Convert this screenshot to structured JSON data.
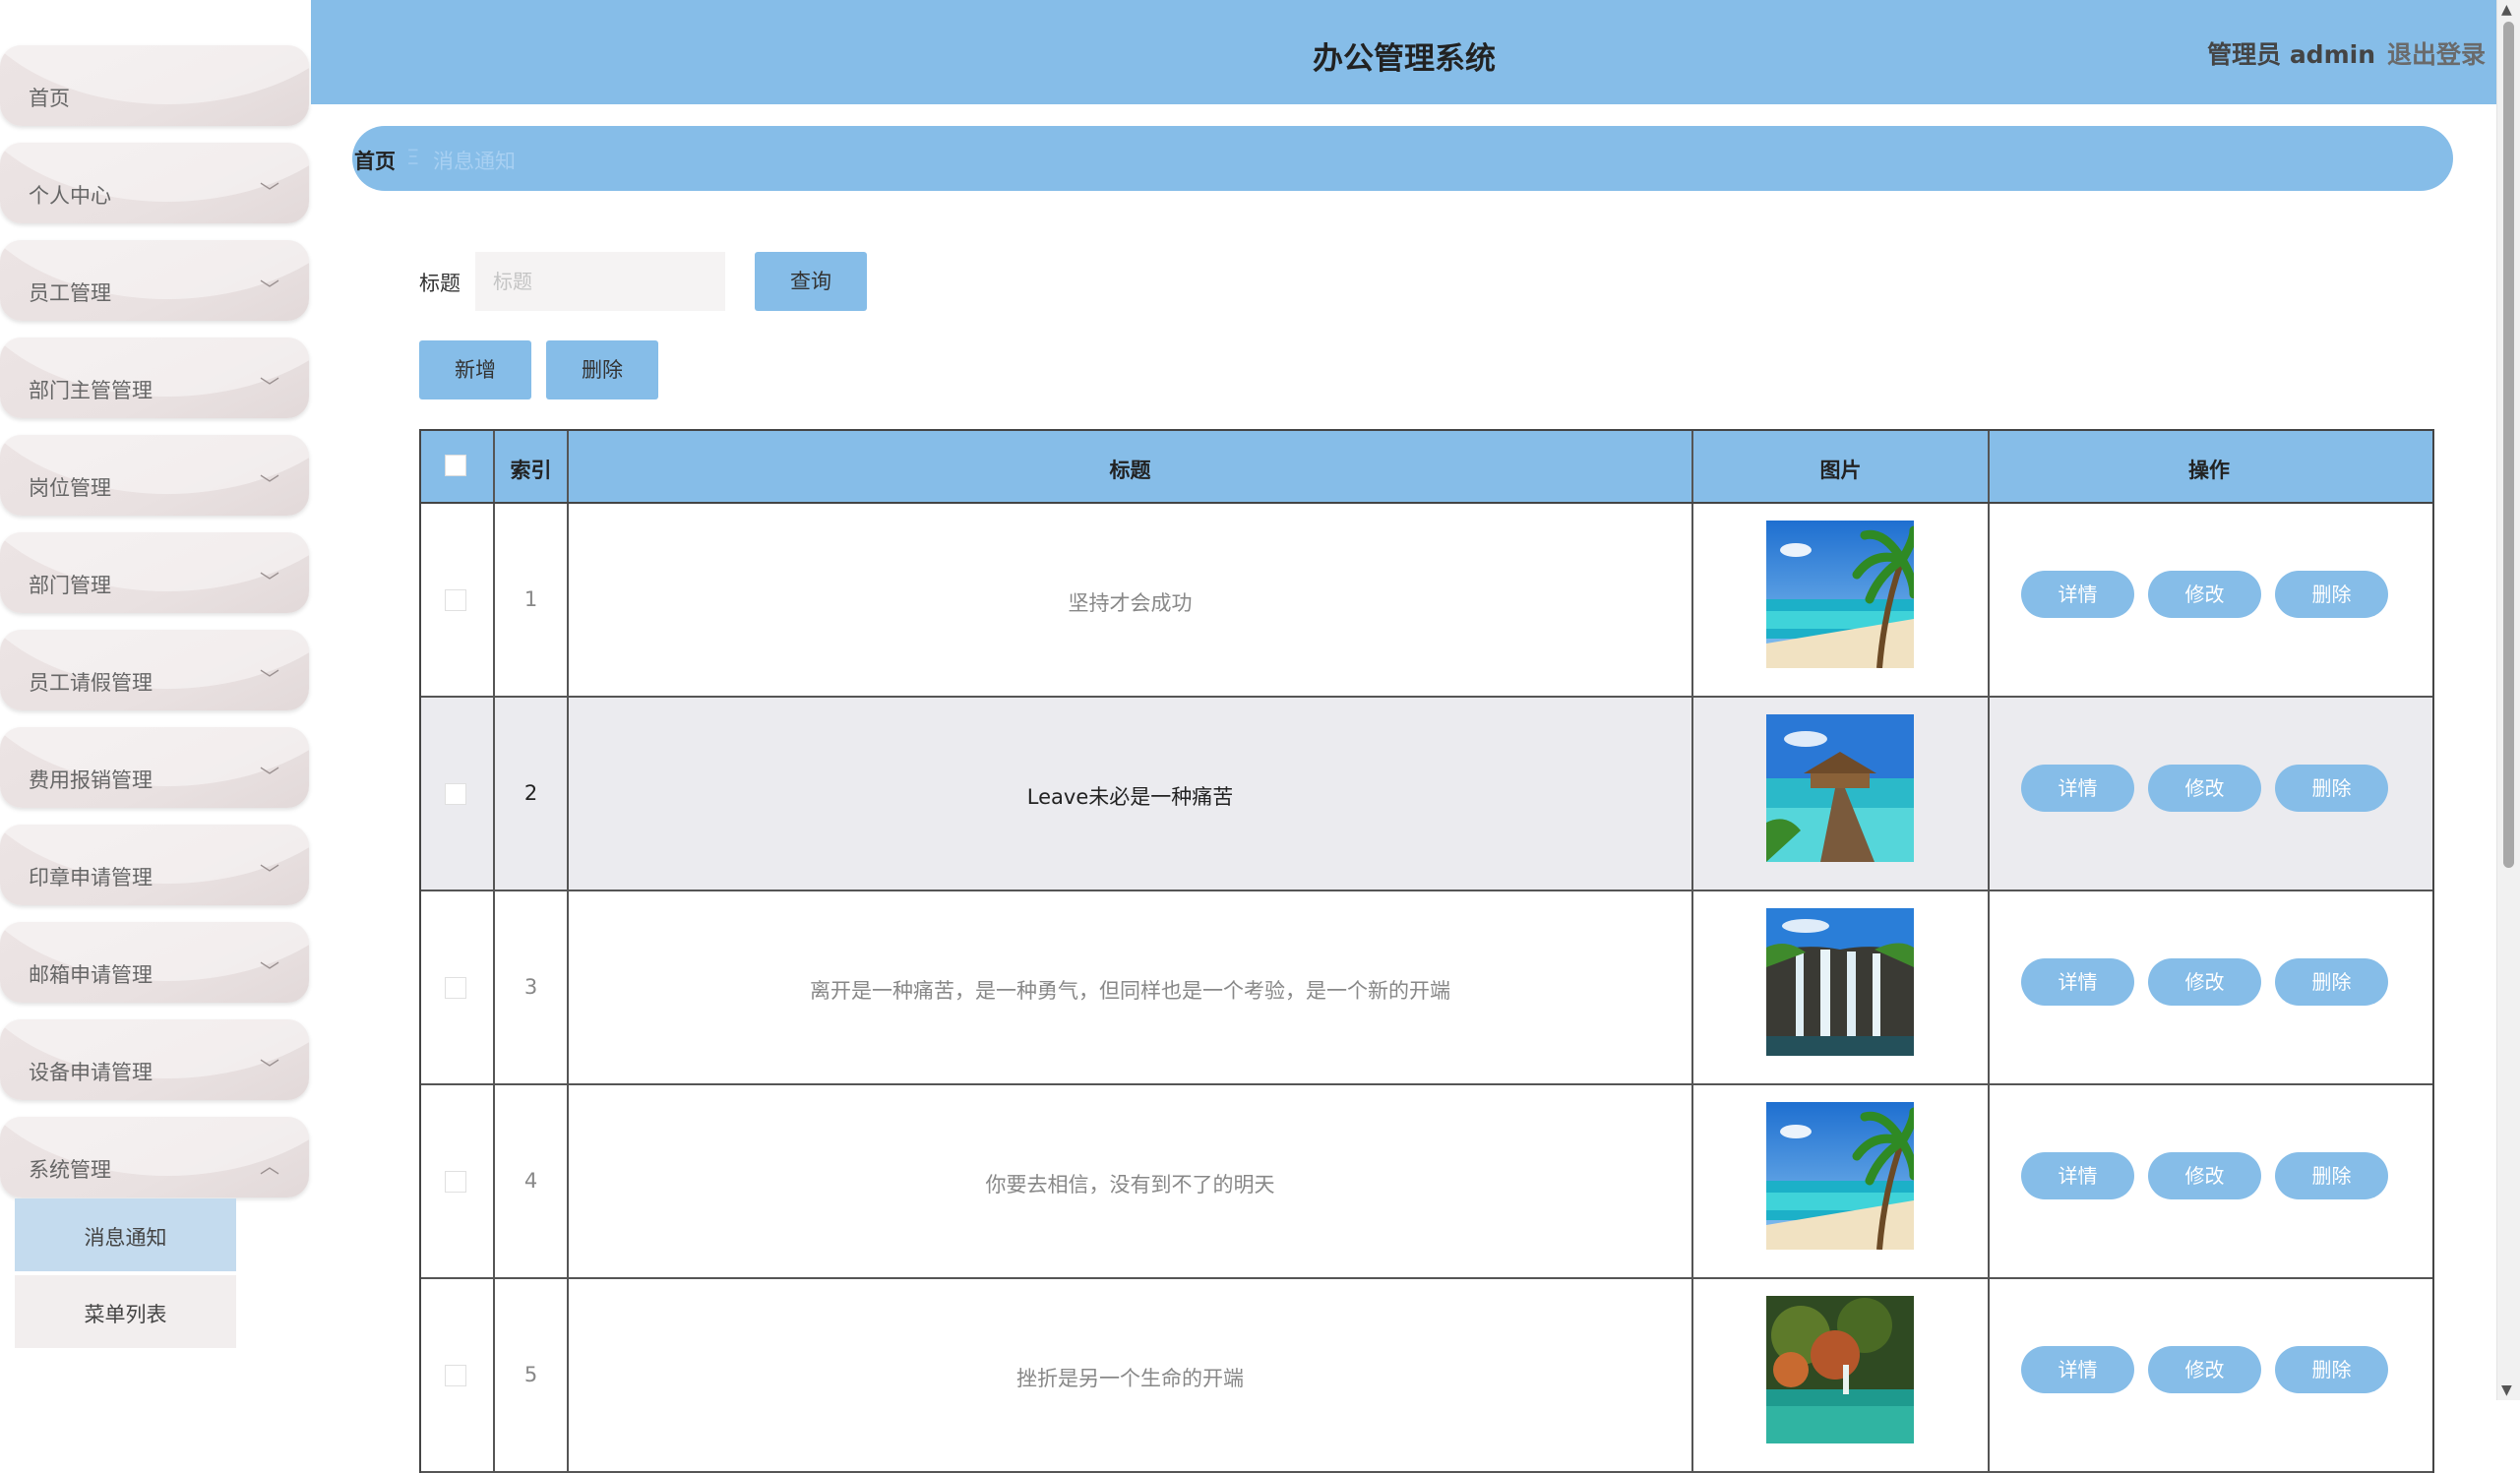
{
  "app": {
    "title": "办公管理系统",
    "user": "管理员 admin",
    "logout": "退出登录"
  },
  "sidebar": {
    "items": [
      {
        "label": "首页",
        "chevron": ""
      },
      {
        "label": "个人中心",
        "chevron": "﹀"
      },
      {
        "label": "员工管理",
        "chevron": "﹀"
      },
      {
        "label": "部门主管管理",
        "chevron": "﹀"
      },
      {
        "label": "岗位管理",
        "chevron": "﹀"
      },
      {
        "label": "部门管理",
        "chevron": "﹀"
      },
      {
        "label": "员工请假管理",
        "chevron": "﹀"
      },
      {
        "label": "费用报销管理",
        "chevron": "﹀"
      },
      {
        "label": "印章申请管理",
        "chevron": "﹀"
      },
      {
        "label": "邮箱申请管理",
        "chevron": "﹀"
      },
      {
        "label": "设备申请管理",
        "chevron": "﹀"
      },
      {
        "label": "系统管理",
        "chevron": "︿"
      }
    ],
    "submenu": [
      {
        "label": "消息通知",
        "active": true
      },
      {
        "label": "菜单列表",
        "active": false
      }
    ]
  },
  "breadcrumb": {
    "home": "首页",
    "separator": "Ξ",
    "current": "消息通知"
  },
  "search": {
    "label": "标题",
    "placeholder": "标题",
    "query_button": "查询"
  },
  "actions": {
    "add": "新增",
    "delete": "删除"
  },
  "table": {
    "headers": {
      "index": "索引",
      "title": "标题",
      "image": "图片",
      "ops": "操作"
    },
    "rows": [
      {
        "index": "1",
        "title": "坚持才会成功",
        "image": "beach-palm"
      },
      {
        "index": "2",
        "title": "Leave未必是一种痛苦",
        "image": "overwater-hut"
      },
      {
        "index": "3",
        "title": "离开是一种痛苦，是一种勇气，但同样也是一个考验，是一个新的开端",
        "image": "waterfall"
      },
      {
        "index": "4",
        "title": "你要去相信，没有到不了的明天",
        "image": "beach-palm"
      },
      {
        "index": "5",
        "title": "挫折是另一个生命的开端",
        "image": "forest-lake"
      }
    ],
    "row_buttons": {
      "detail": "详情",
      "edit": "修改",
      "delete": "删除"
    }
  },
  "colors": {
    "accent": "#86bde8",
    "submenu_active": "#c4dbee",
    "row_alt": "#ebebef"
  }
}
